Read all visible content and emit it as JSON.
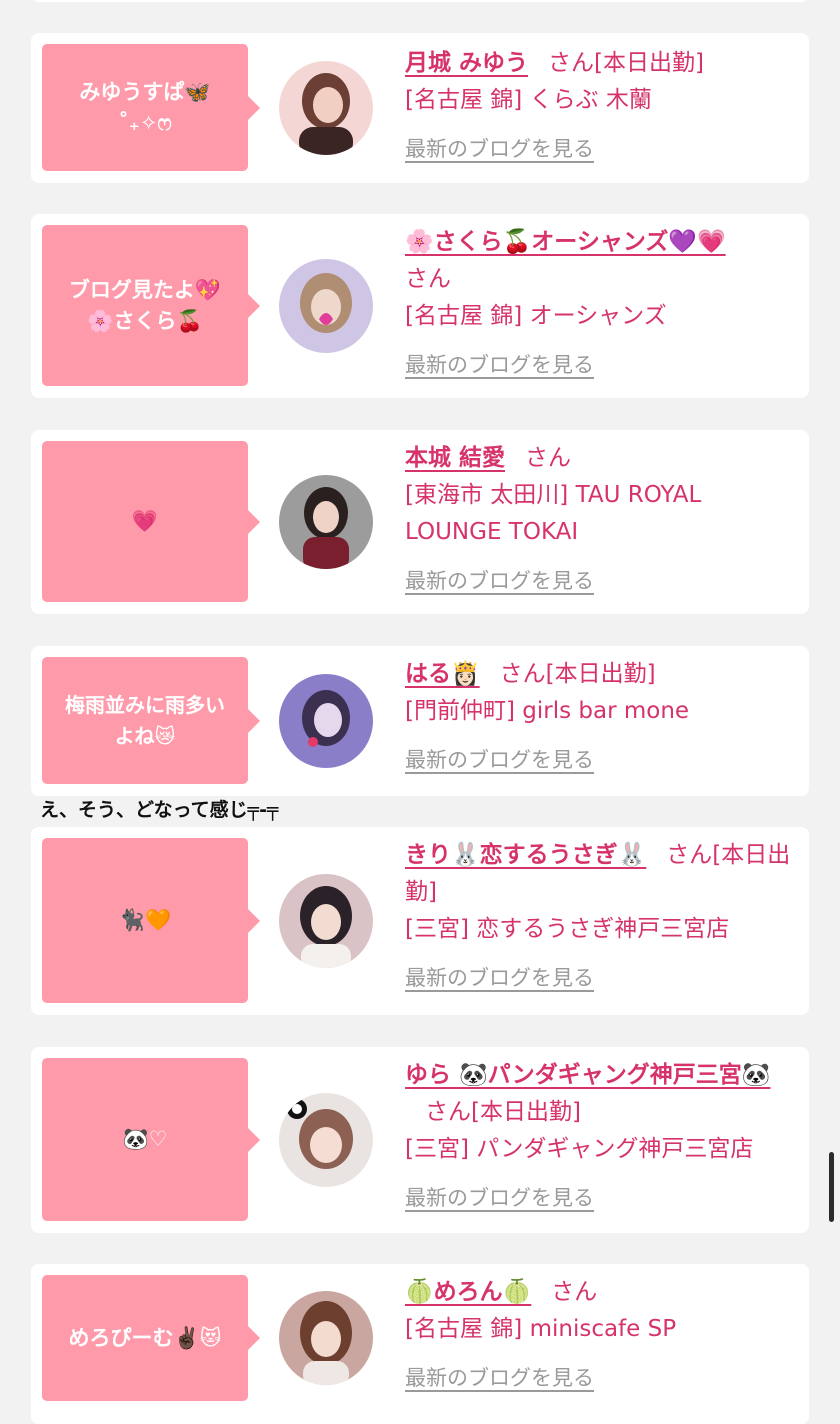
{
  "cards": [
    {
      "bubble": "みゆうすぱ🦋\n˚₊✧ෆ",
      "name": "月城 みゆう",
      "suffix": "さん[本日出勤]",
      "shop": "[名古屋 錦] くらぶ 木蘭",
      "blog": "最新のブログを見る",
      "avatar": "portrait-1"
    },
    {
      "bubble": "ブログ見たよ💖\n🌸さくら🍒",
      "name": "🌸さくら🍒オーシャンズ💜💗",
      "suffix": "さん",
      "shop": "[名古屋 錦] オーシャンズ",
      "blog": "最新のブログを見る",
      "avatar": "portrait-2"
    },
    {
      "bubble": "💗",
      "name": "本城 結愛",
      "suffix": "さん",
      "shop": "[東海市 太田川] TAU ROYAL LOUNGE TOKAI",
      "blog": "最新のブログを見る",
      "avatar": "portrait-3"
    },
    {
      "bubble": "梅雨並みに雨多い\nよね😿",
      "name": "はる👸🏻",
      "suffix": "さん[本日出勤]",
      "shop": "[門前仲町] girls bar mone",
      "blog": "最新のブログを見る",
      "avatar": "portrait-4"
    },
    {
      "bubble": "🐈‍⬛🧡",
      "name": "きり🐰恋するうさぎ🐰",
      "suffix": "さん[本日出勤]",
      "shop": "[三宮] 恋するうさぎ神戸三宮店",
      "blog": "最新のブログを見る",
      "avatar": "portrait-5"
    },
    {
      "bubble": "🐼♡",
      "name": "ゆら 🐼パンダギャング神戸三宮🐼",
      "suffix": "さん[本日出勤]",
      "shop": "[三宮] パンダギャング神戸三宮店",
      "blog": "最新のブログを見る",
      "avatar": "portrait-6"
    },
    {
      "bubble": "めろぴーむ✌🏿😻",
      "name": "🍈めろん🍈",
      "suffix": "さん",
      "shop": "[名古屋 錦] miniscafe SP",
      "blog": "最新のブログを見る",
      "avatar": "portrait-7"
    }
  ],
  "overlay_caption": "え、そう、どなって感じ╤-╤",
  "colors": {
    "accent": "#d6336c",
    "bubble": "#ff9aab",
    "link": "#9a9a9a",
    "background": "#f2f2f2"
  }
}
